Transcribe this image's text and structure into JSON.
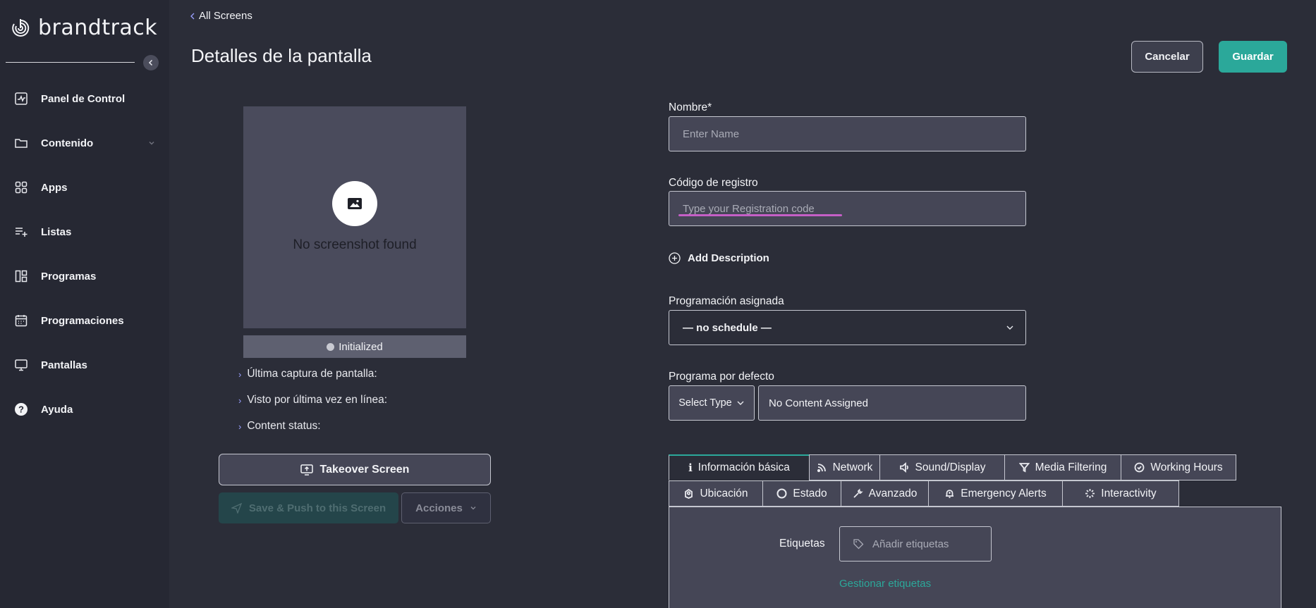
{
  "brand": {
    "name": "brandtrack"
  },
  "sidebar": {
    "items": [
      {
        "label": "Panel de Control",
        "icon": "dashboard-icon"
      },
      {
        "label": "Contenido",
        "icon": "folder-icon",
        "expandable": true
      },
      {
        "label": "Apps",
        "icon": "apps-grid-icon"
      },
      {
        "label": "Listas",
        "icon": "playlist-add-icon"
      },
      {
        "label": "Programas",
        "icon": "layout-icon"
      },
      {
        "label": "Programaciones",
        "icon": "calendar-icon"
      },
      {
        "label": "Pantallas",
        "icon": "monitor-icon"
      },
      {
        "label": "Ayuda",
        "icon": "help-icon"
      }
    ]
  },
  "header": {
    "back_label": "All Screens",
    "title": "Detalles de la pantalla",
    "cancel_label": "Cancelar",
    "save_label": "Guardar"
  },
  "preview": {
    "empty_text": "No screenshot found",
    "status": "Initialized",
    "info": [
      "Última captura de pantalla:",
      "Visto por última vez en línea:",
      "Content status:"
    ],
    "takeover_label": "Takeover Screen",
    "push_label": "Save & Push to this Screen",
    "actions_label": "Acciones"
  },
  "form": {
    "name_label": "Nombre*",
    "name_placeholder": "Enter Name",
    "code_label": "Código de registro",
    "code_placeholder": "Type your Registration code",
    "add_description_label": "Add Description",
    "schedule_label": "Programación asignada",
    "schedule_value": "— no schedule —",
    "default_program_label": "Programa por defecto",
    "type_select_value": "Select Type",
    "content_value": "No Content Assigned"
  },
  "tabs": {
    "row1": [
      "Información básica",
      "Network",
      "Sound/Display",
      "Media Filtering",
      "Working Hours"
    ],
    "row2": [
      "Ubicación",
      "Estado",
      "Avanzado",
      "Emergency Alerts",
      "Interactivity"
    ]
  },
  "tags": {
    "label": "Etiquetas",
    "placeholder": "Añadir etiquetas",
    "manage_link": "Gestionar etiquetas"
  },
  "colors": {
    "accent": "#2ba89a",
    "background": "#2b2d38",
    "card": "#4a4b5c",
    "highlight_underline": "#c55fc6"
  }
}
